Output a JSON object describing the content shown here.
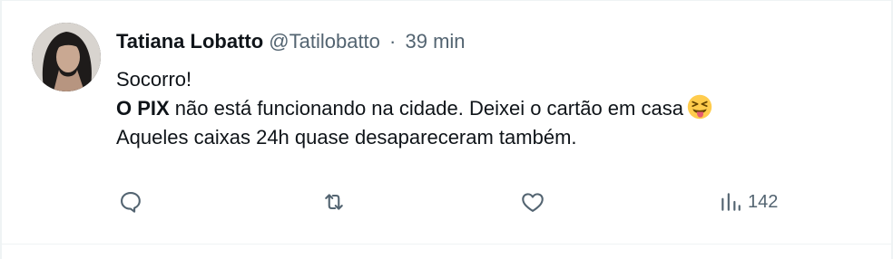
{
  "tweet": {
    "display_name": "Tatiana Lobatto",
    "handle": "@Tatilobatto",
    "separator": "·",
    "time": "39 min",
    "lines": {
      "line1": "Socorro!",
      "line2_bold": "O PIX",
      "line2_rest": " não está funcionando na cidade. Deixei o cartão em casa",
      "line3": "Aqueles caixas 24h quase desapareceram também."
    },
    "emoji": "squinting-tongue-face-icon"
  },
  "actions": {
    "reply_icon": "reply-icon",
    "retweet_icon": "retweet-icon",
    "like_icon": "like-icon",
    "views_icon": "views-icon",
    "views_count": "142"
  },
  "colors": {
    "text": "#0f1419",
    "secondary": "#536471",
    "border": "#eff3f4"
  }
}
